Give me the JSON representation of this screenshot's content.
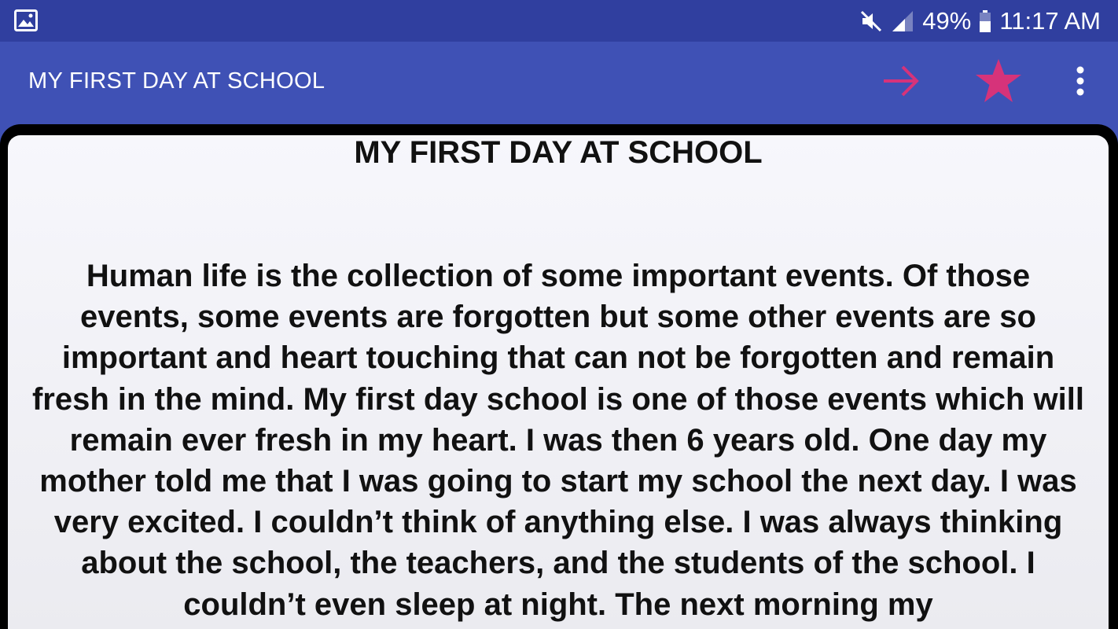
{
  "status_bar": {
    "battery_percent": "49%",
    "time": "11:17 AM",
    "icons": [
      "image-icon",
      "mute-icon",
      "signal-icon",
      "battery-icon"
    ]
  },
  "app_bar": {
    "title": "MY FIRST DAY AT SCHOOL",
    "actions": [
      "next-arrow-icon",
      "favorite-star-icon",
      "more-options-icon"
    ],
    "accent_color": "#d6337a",
    "background_color": "#3f51b5",
    "status_color": "#303f9f"
  },
  "content": {
    "title": "MY FIRST DAY AT SCHOOL",
    "body": "Human life is the collection of some important events. Of those events, some events are forgotten but some other events are so important and heart touching that can not be forgotten and remain fresh in the mind. My first day school is one of those events which will remain ever fresh in my heart. I was then 6 years old. One day my mother told me that I was going to start my school the next day. I was very excited. I couldn’t think of anything else. I was always thinking about the school, the teachers, and the students of the school. I couldn’t even sleep at night. The next morning my"
  }
}
